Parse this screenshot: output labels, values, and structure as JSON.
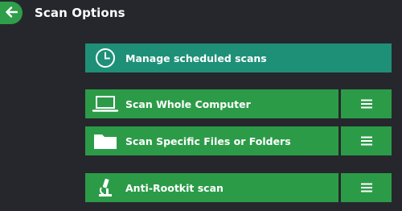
{
  "header": {
    "title": "Scan Options",
    "back_icon": "arrow-left-icon"
  },
  "scheduled": {
    "label": "Manage scheduled scans",
    "icon": "clock-icon",
    "color": "#1e9078"
  },
  "scans": [
    {
      "label": "Scan Whole Computer",
      "icon": "laptop-icon",
      "menu_icon": "hamburger-menu-icon"
    },
    {
      "label": "Scan Specific Files or Folders",
      "icon": "folder-icon",
      "menu_icon": "hamburger-menu-icon"
    },
    {
      "label": "Anti-Rootkit scan",
      "icon": "microscope-icon",
      "menu_icon": "hamburger-menu-icon"
    }
  ],
  "colors": {
    "background": "#26272c",
    "accent_green": "#2c9b48",
    "teal": "#1e9078"
  }
}
